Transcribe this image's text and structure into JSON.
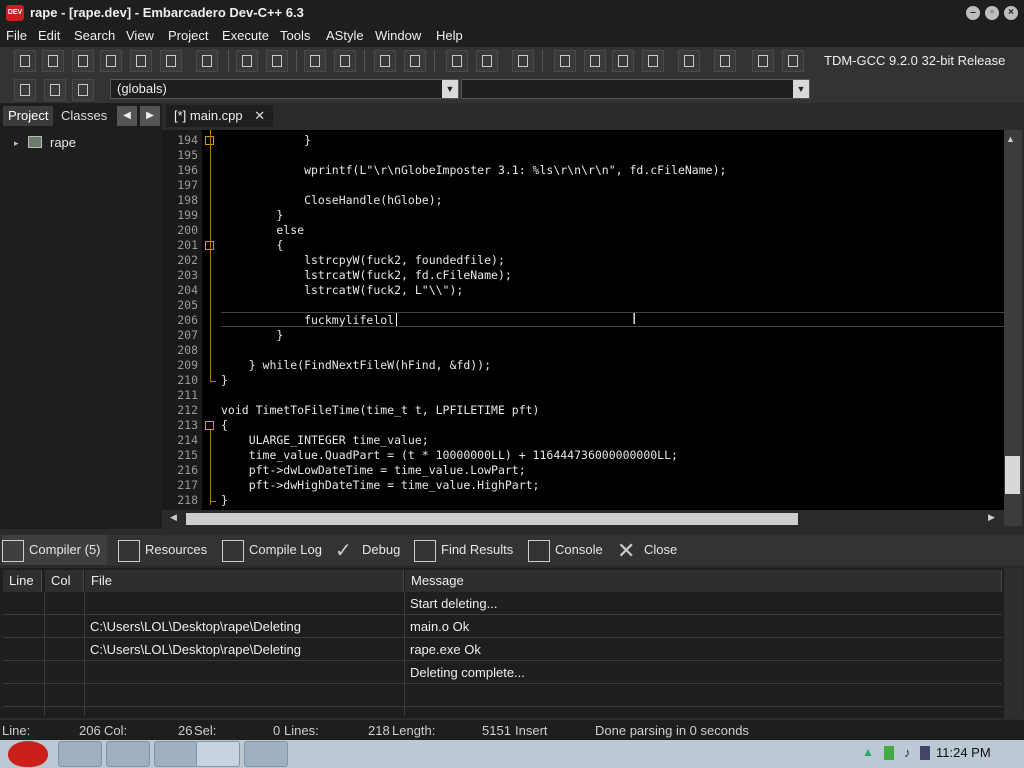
{
  "window": {
    "title": "rape - [rape.dev] - Embarcadero Dev-C++ 6.3",
    "app_icon_text": "DEV"
  },
  "menu": [
    "File",
    "Edit",
    "Search",
    "View",
    "Project",
    "Execute",
    "Tools",
    "AStyle",
    "Window",
    "Help"
  ],
  "toolbar": {
    "compiler": "TDM-GCC 9.2.0 32-bit Release",
    "scope_combo": "(globals)",
    "scope_combo2": ""
  },
  "left_panel": {
    "tabs": [
      "Project",
      "Classes"
    ],
    "tree_root": "rape"
  },
  "editor": {
    "tab_label": "[*] main.cpp",
    "close_glyph": "✕",
    "current_line": 206,
    "lines": [
      {
        "n": "194",
        "code": "            }"
      },
      {
        "n": "195",
        "code": ""
      },
      {
        "n": "196",
        "code": "            wprintf(L\"\\r\\nGlobeImposter 3.1: %ls\\r\\n\\r\\n\", fd.cFileName);"
      },
      {
        "n": "197",
        "code": ""
      },
      {
        "n": "198",
        "code": "            CloseHandle(hGlobe);"
      },
      {
        "n": "199",
        "code": "        }"
      },
      {
        "n": "200",
        "code": "        else"
      },
      {
        "n": "201",
        "code": "        {"
      },
      {
        "n": "202",
        "code": "            lstrcpyW(fuck2, foundedfile);"
      },
      {
        "n": "203",
        "code": "            lstrcatW(fuck2, fd.cFileName);"
      },
      {
        "n": "204",
        "code": "            lstrcatW(fuck2, L\"\\\\\");"
      },
      {
        "n": "205",
        "code": ""
      },
      {
        "n": "206",
        "code": "            fuckmylifelol"
      },
      {
        "n": "207",
        "code": "        }"
      },
      {
        "n": "208",
        "code": ""
      },
      {
        "n": "209",
        "code": "    } while(FindNextFileW(hFind, &fd));"
      },
      {
        "n": "210",
        "code": "}"
      },
      {
        "n": "211",
        "code": ""
      },
      {
        "n": "212",
        "code": "void TimetToFileTime(time_t t, LPFILETIME pft)"
      },
      {
        "n": "213",
        "code": "{"
      },
      {
        "n": "214",
        "code": "    ULARGE_INTEGER time_value;"
      },
      {
        "n": "215",
        "code": "    time_value.QuadPart = (t * 10000000LL) + 116444736000000000LL;"
      },
      {
        "n": "216",
        "code": "    pft->dwLowDateTime = time_value.LowPart;"
      },
      {
        "n": "217",
        "code": "    pft->dwHighDateTime = time_value.HighPart;"
      },
      {
        "n": "218",
        "code": "}"
      }
    ]
  },
  "bottom_tabs": [
    "Compiler (5)",
    "Resources",
    "Compile Log",
    "Debug",
    "Find Results",
    "Console",
    "Close"
  ],
  "results": {
    "columns": [
      "Line",
      "Col",
      "File",
      "Message"
    ],
    "rows": [
      {
        "line": "",
        "col": "",
        "file": "",
        "message": "Start deleting..."
      },
      {
        "line": "",
        "col": "",
        "file": "C:\\Users\\LOL\\Desktop\\rape\\Deleting",
        "message": "main.o Ok"
      },
      {
        "line": "",
        "col": "",
        "file": "C:\\Users\\LOL\\Desktop\\rape\\Deleting",
        "message": "rape.exe Ok"
      },
      {
        "line": "",
        "col": "",
        "file": "",
        "message": "Deleting complete..."
      },
      {
        "line": "",
        "col": "",
        "file": "",
        "message": ""
      }
    ]
  },
  "status": {
    "line_label": "Line:",
    "line_value": "206",
    "col_label": "Col:",
    "col_value": "26",
    "sel_label": "Sel:",
    "sel_value": "0",
    "lines_label": "Lines:",
    "lines_value": "218",
    "length_label": "Length:",
    "length_value": "5151",
    "mode": "Insert",
    "message": "Done parsing in 0 seconds"
  },
  "taskbar": {
    "clock": "11:24 PM"
  }
}
